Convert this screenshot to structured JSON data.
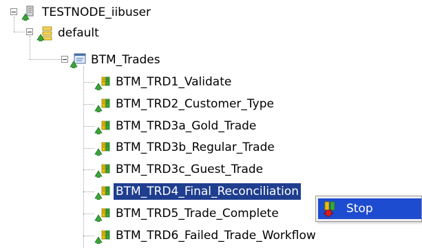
{
  "tree": {
    "root": {
      "label": "TESTNODE_iibuser",
      "icon": "integration-node-icon"
    },
    "server": {
      "label": "default",
      "icon": "integration-server-icon"
    },
    "application": {
      "label": "BTM_Trades",
      "icon": "application-icon"
    },
    "flows": [
      {
        "label": "BTM_TRD1_Validate",
        "icon": "message-flow-icon"
      },
      {
        "label": "BTM_TRD2_Customer_Type",
        "icon": "message-flow-icon"
      },
      {
        "label": "BTM_TRD3a_Gold_Trade",
        "icon": "message-flow-icon"
      },
      {
        "label": "BTM_TRD3b_Regular_Trade",
        "icon": "message-flow-icon"
      },
      {
        "label": "BTM_TRD3c_Guest_Trade",
        "icon": "message-flow-icon"
      },
      {
        "label": "BTM_TRD4_Final_Reconciliation",
        "icon": "message-flow-icon",
        "selected": true
      },
      {
        "label": "BTM_TRD5_Trade_Complete",
        "icon": "message-flow-icon"
      },
      {
        "label": "BTM_TRD6_Failed_Trade_Workflow",
        "icon": "message-flow-icon"
      }
    ]
  },
  "context_menu": {
    "items": [
      {
        "label": "Stop",
        "icon": "stop-flow-icon"
      }
    ]
  },
  "colors": {
    "selection_bg": "#1f3e8f",
    "menu_highlight": "#1e4cd0",
    "flow_icon_green": "#2e9e2e",
    "flow_icon_yellow": "#e6c200"
  }
}
